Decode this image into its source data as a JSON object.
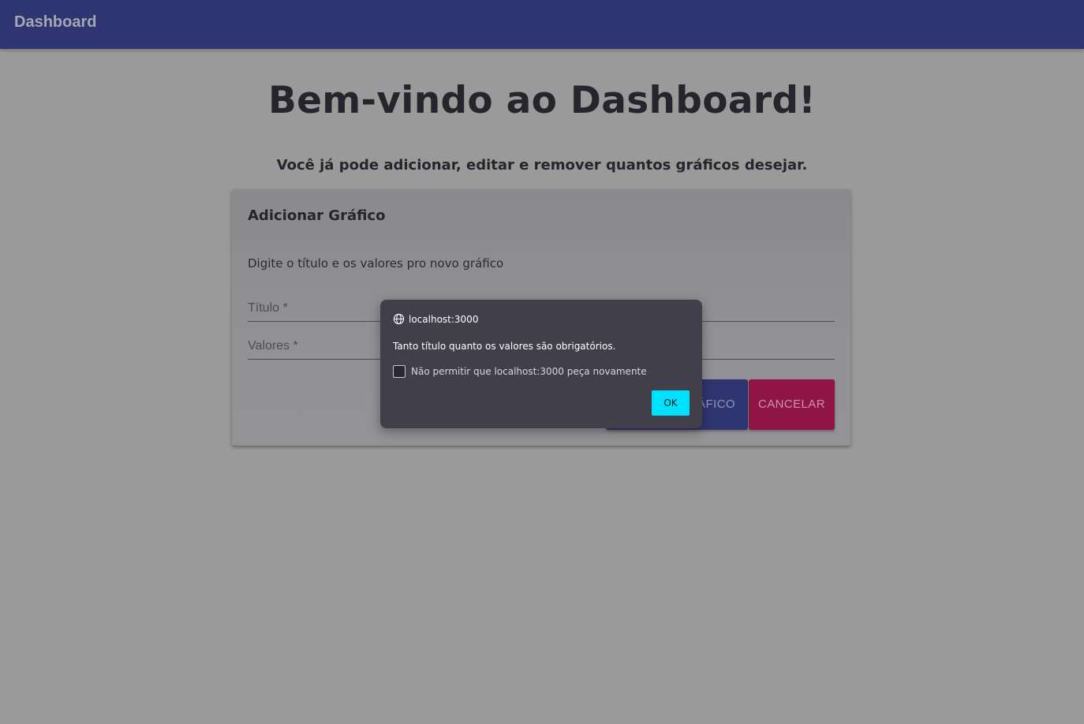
{
  "appbar": {
    "title": "Dashboard"
  },
  "hero": {
    "title": "Bem-vindo ao Dashboard!",
    "subtitle": "Você já pode adicionar, editar e remover quantos gráficos desejar."
  },
  "card": {
    "title": "Adicionar Gráfico",
    "description": "Digite o título e os valores pro novo gráfico",
    "fields": {
      "title_label": "Título *",
      "values_label": "Valores *"
    },
    "buttons": {
      "add_label_visible": "ÁFICO",
      "cancel_label": "CANCELAR"
    }
  },
  "dialog": {
    "origin": "localhost:3000",
    "message": "Tanto título quanto os valores são obrigatórios.",
    "checkbox_label": "Não permitir que localhost:3000 peça novamente",
    "checkbox_checked": false,
    "ok_label": "OK"
  },
  "colors": {
    "appbar": "#2f3570",
    "primary_button": "#2f3570",
    "cancel_button": "#8e1544",
    "ok_button": "#00e1ff",
    "dialog_background": "#413f4a"
  }
}
